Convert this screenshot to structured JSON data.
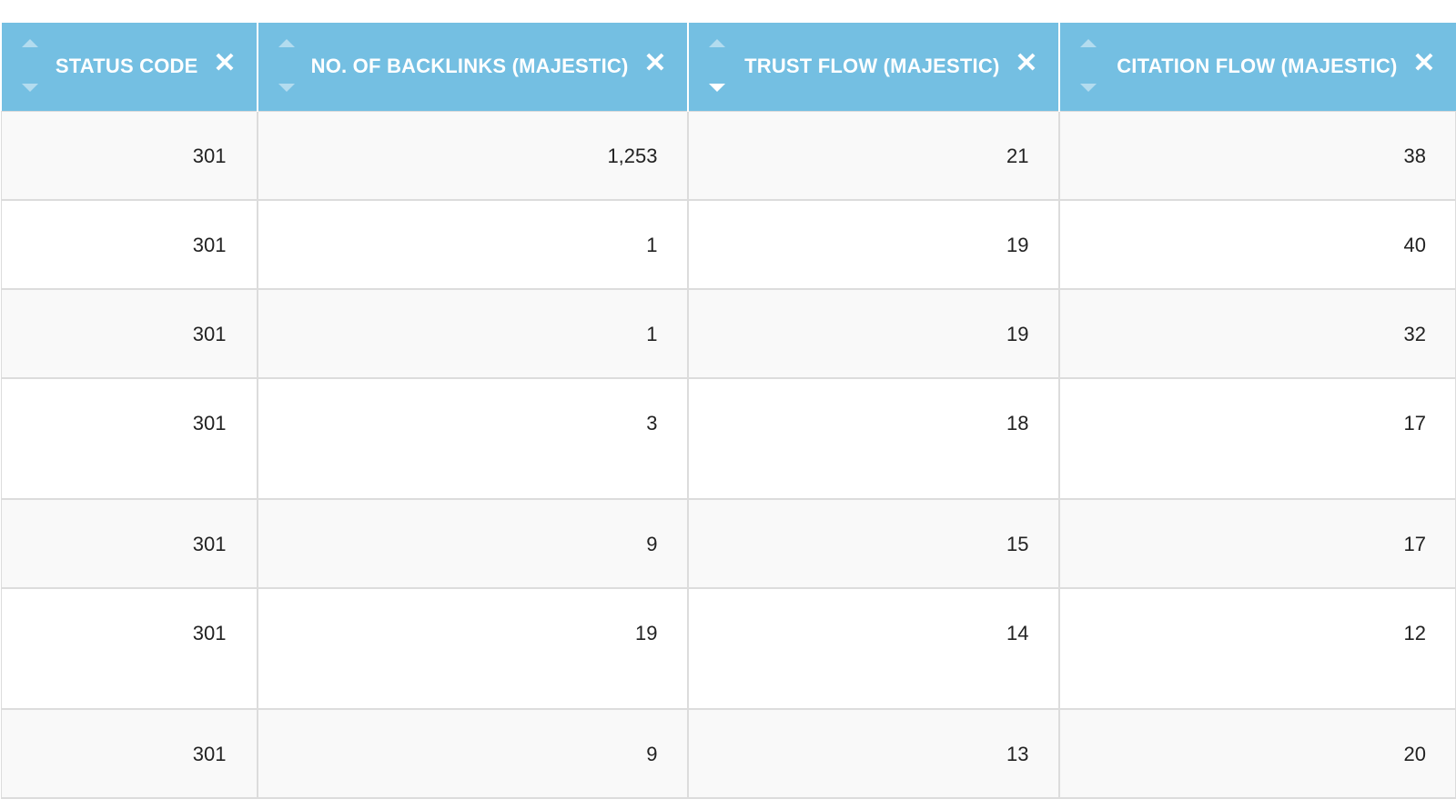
{
  "columns": [
    {
      "label": "STATUS CODE"
    },
    {
      "label": "NO. OF BACKLINKS (MAJESTIC)"
    },
    {
      "label": "TRUST FLOW (MAJESTIC)"
    },
    {
      "label": "CITATION FLOW (MAJESTIC)"
    }
  ],
  "icons": {
    "sort_up": "sort-ascending-icon",
    "sort_down": "sort-descending-icon",
    "close": "close-icon",
    "close_glyph": "✕"
  },
  "colors": {
    "header_bg": "#74bfe2",
    "header_text": "#ffffff",
    "row_odd_bg": "#f9f9f9",
    "row_even_bg": "#ffffff",
    "grid": "#dcdcdc"
  },
  "rows": [
    [
      "301",
      "1,253",
      "21",
      "38"
    ],
    [
      "301",
      "1",
      "19",
      "40"
    ],
    [
      "301",
      "1",
      "19",
      "32"
    ],
    [
      "301",
      "3",
      "18",
      "17"
    ],
    [
      "301",
      "9",
      "15",
      "17"
    ],
    [
      "301",
      "19",
      "14",
      "12"
    ],
    [
      "301",
      "9",
      "13",
      "20"
    ]
  ]
}
